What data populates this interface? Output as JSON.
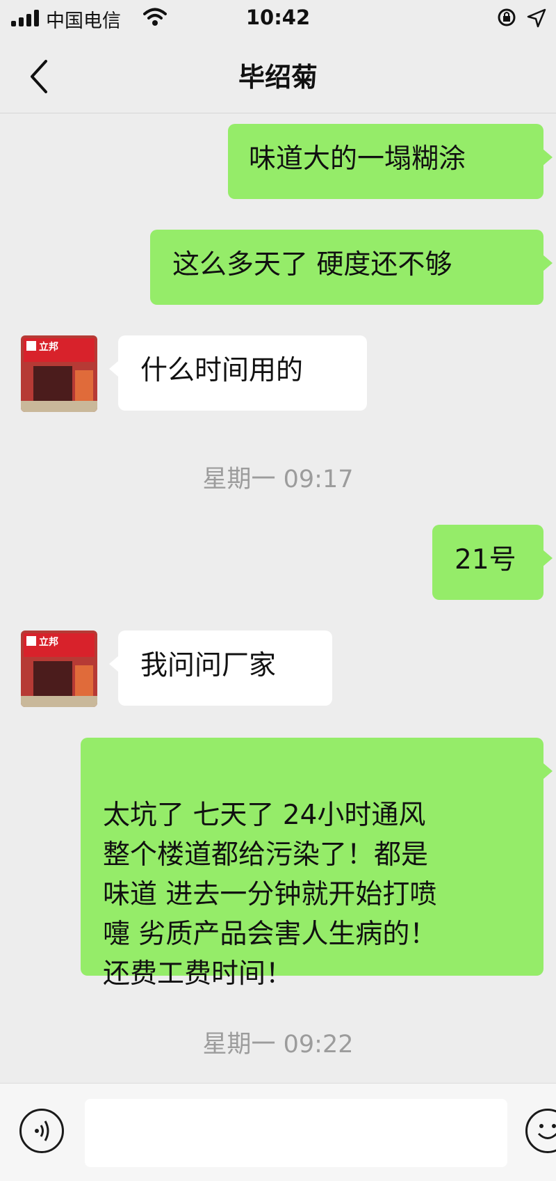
{
  "status_bar": {
    "carrier": "中国电信",
    "time": "10:42"
  },
  "nav": {
    "title": "毕绍菊"
  },
  "messages": [
    {
      "side": "out",
      "text": "味道大的一塌糊涂"
    },
    {
      "side": "out",
      "text": "这么多天了 硬度还不够"
    },
    {
      "side": "in",
      "text": "什么时间用的"
    },
    {
      "side": "time",
      "text": "星期一 09:17"
    },
    {
      "side": "out",
      "text": "21号"
    },
    {
      "side": "in",
      "text": "我问问厂家"
    },
    {
      "side": "out",
      "text": "太坑了 七天了 24小时通风\n整个楼道都给污染了！都是\n味道 进去一分钟就开始打喷\n嚏 劣质产品会害人生病的！\n还费工费时间！"
    },
    {
      "side": "time",
      "text": "星期一 09:22"
    }
  ],
  "contact_avatar": {
    "brand": "立邦"
  },
  "input_bar": {
    "value": "",
    "placeholder": ""
  },
  "colors": {
    "background": "#ededed",
    "outgoing_bubble": "#95ec69",
    "incoming_bubble": "#ffffff",
    "timestamp": "#9c9c9c"
  },
  "icons": [
    "signal-icon",
    "wifi-icon",
    "orientation-lock-icon",
    "location-arrow-icon",
    "back-chevron-icon",
    "voice-icon",
    "emoji-icon"
  ]
}
